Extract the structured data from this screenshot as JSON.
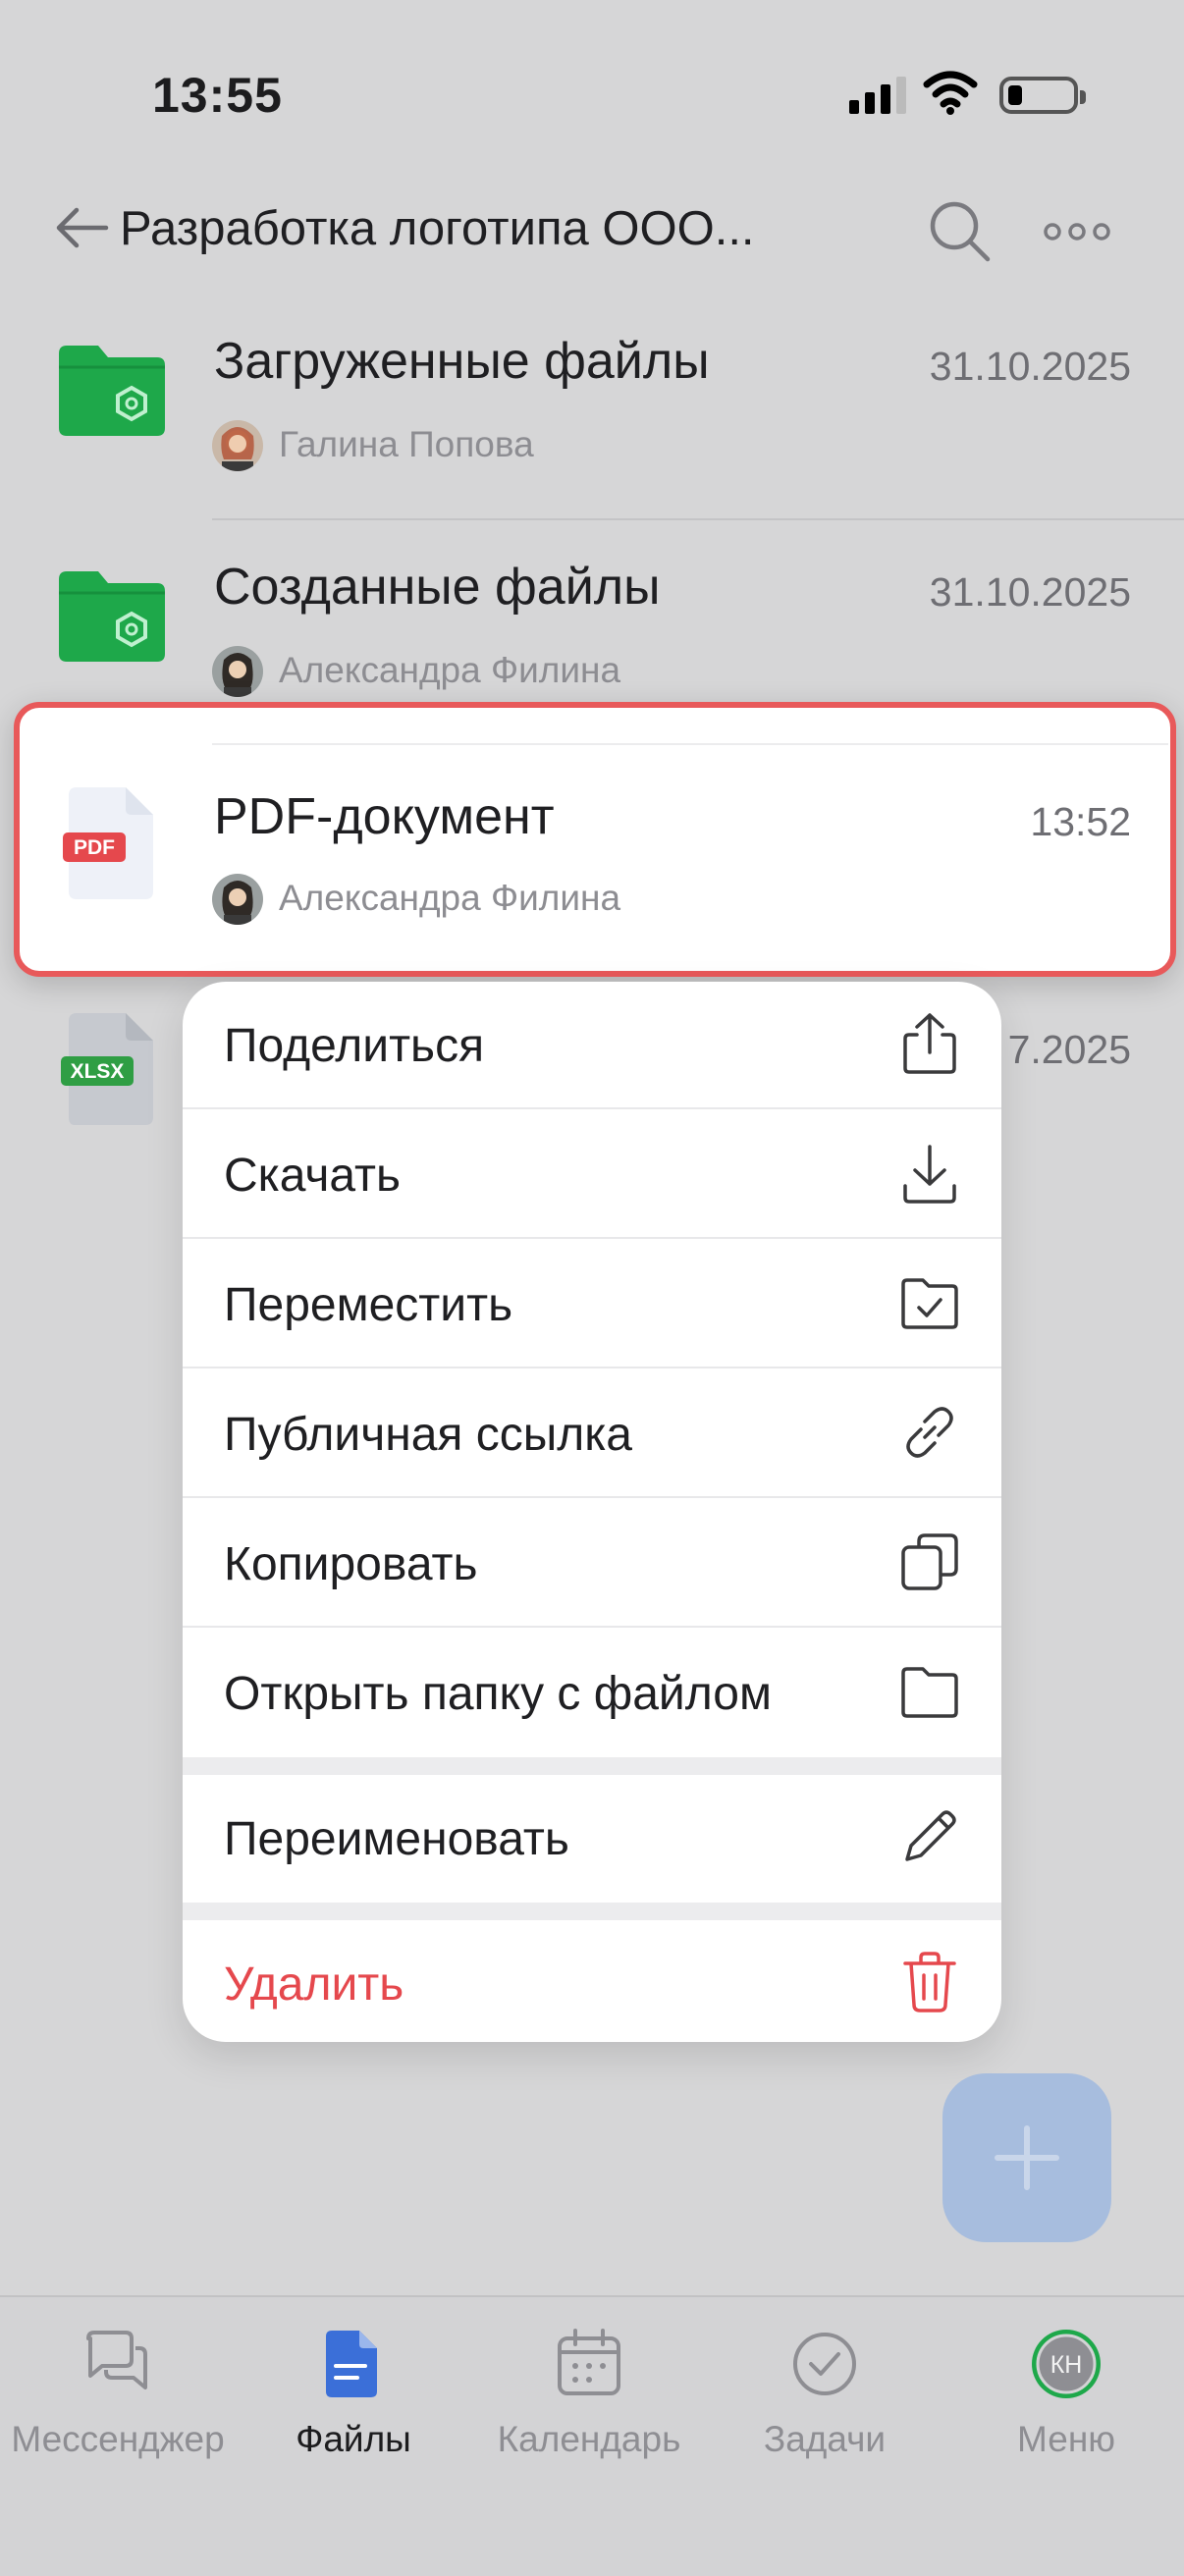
{
  "status": {
    "time": "13:55"
  },
  "header": {
    "title": "Разработка логотипа ООО..."
  },
  "rows": [
    {
      "title": "Загруженные файлы",
      "date": "31.10.2025",
      "author": "Галина Попова",
      "icon": "folder-icon"
    },
    {
      "title": "Созданные файлы",
      "date": "31.10.2025",
      "author": "Александра Филина",
      "icon": "folder-icon"
    },
    {
      "title": "PDF-документ",
      "date": "13:52",
      "author": "Александра Филина",
      "icon": "pdf-file-icon",
      "badge": "PDF"
    },
    {
      "title": "",
      "date": "7.2025",
      "author": "",
      "icon": "xlsx-file-icon",
      "badge": "XLSX"
    }
  ],
  "menu": {
    "items": [
      {
        "label": "Поделиться",
        "icon": "share-icon"
      },
      {
        "label": "Скачать",
        "icon": "download-icon"
      },
      {
        "label": "Переместить",
        "icon": "move-folder-icon"
      },
      {
        "label": "Публичная ссылка",
        "icon": "link-icon"
      },
      {
        "label": "Копировать",
        "icon": "copy-icon"
      },
      {
        "label": "Открыть папку с файлом",
        "icon": "folder-open-icon"
      },
      {
        "label": "Переименовать",
        "icon": "pencil-icon"
      },
      {
        "label": "Удалить",
        "icon": "trash-icon"
      }
    ]
  },
  "fab": {
    "icon": "plus-icon"
  },
  "tabs": [
    {
      "label": "Мессенджер",
      "icon": "chat-icon",
      "active": false
    },
    {
      "label": "Файлы",
      "icon": "file-icon",
      "active": true
    },
    {
      "label": "Календарь",
      "icon": "calendar-icon",
      "active": false
    },
    {
      "label": "Задачи",
      "icon": "check-circle-icon",
      "active": false
    },
    {
      "label": "Меню",
      "icon": "avatar-icon",
      "initials": "КН",
      "active": false
    }
  ],
  "colors": {
    "accent": "#3b6fd8",
    "danger": "#e5484d",
    "folder": "#1ea84a",
    "highlight_border": "#e8595a"
  }
}
